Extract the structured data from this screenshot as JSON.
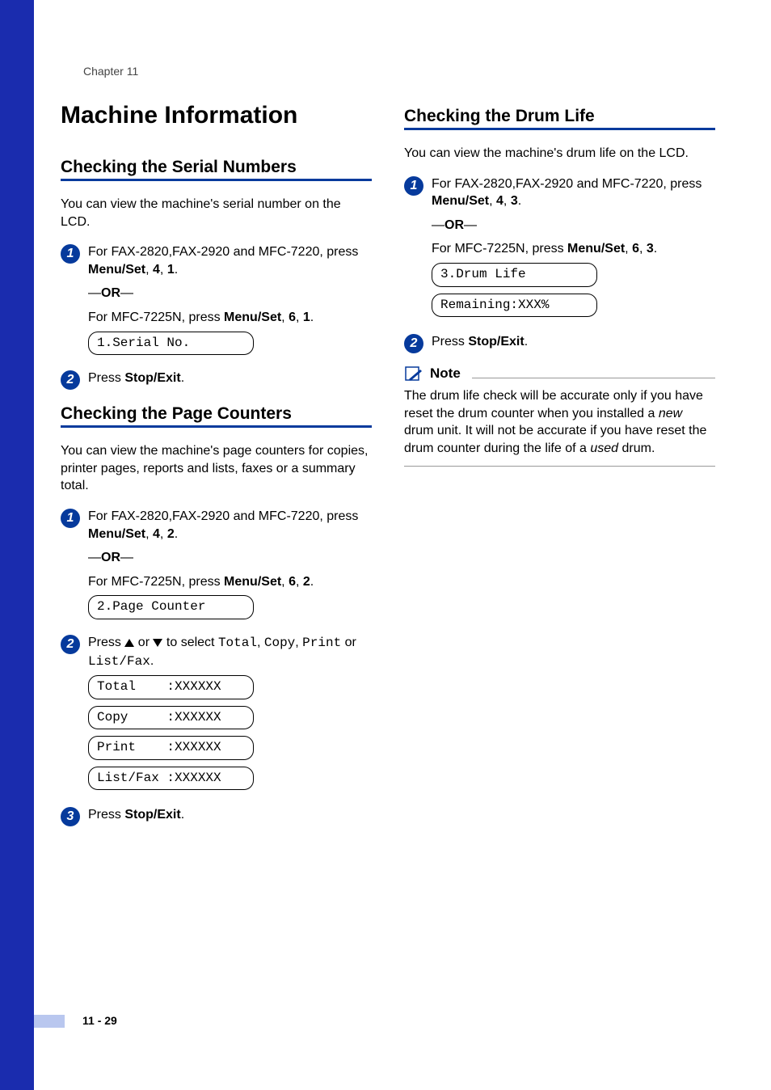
{
  "chapter": "Chapter 11",
  "page_number": "11 - 29",
  "h1": "Machine Information",
  "left": {
    "section1": {
      "heading": "Checking the Serial Numbers",
      "intro": "You can view the machine's serial number on the LCD.",
      "step1_a": "For FAX-2820,FAX-2920 and MFC-7220, press ",
      "menu_set": "Menu/Set",
      "comma": ", ",
      "four": "4",
      "one": "1",
      "period": ".",
      "or": "OR",
      "step1_b_pre": "For MFC-7225N, press ",
      "six": "6",
      "lcd1": "1.Serial No.",
      "step2_pre": "Press ",
      "stop_exit": "Stop/Exit",
      "step2_post": "."
    },
    "section2": {
      "heading": "Checking the Page Counters",
      "intro": "You can view the machine's page counters for copies, printer pages, reports and lists, faxes or a summary total.",
      "step1_a": "For FAX-2820,FAX-2920 and MFC-7220, press ",
      "menu_set": "Menu/Set",
      "comma": ", ",
      "four": "4",
      "two": "2",
      "period": ".",
      "or": "OR",
      "step1_b_pre": "For MFC-7225N, press ",
      "six": "6",
      "lcd1": "2.Page Counter",
      "step2_pre": "Press ",
      "step2_mid1": " or ",
      "step2_mid2": " to select ",
      "opt_total": "Total",
      "opt_copy": "Copy",
      "opt_print": "Print",
      "step2_or": " or ",
      "opt_listfax": "List/Fax",
      "step2_end": ".",
      "sep": ", ",
      "lcd_total": "Total    :XXXXXX",
      "lcd_copy": "Copy     :XXXXXX",
      "lcd_print": "Print    :XXXXXX",
      "lcd_listfax": "List/Fax :XXXXXX",
      "step3_pre": "Press ",
      "stop_exit": "Stop/Exit",
      "step3_post": "."
    }
  },
  "right": {
    "section1": {
      "heading": "Checking the Drum Life",
      "intro": "You can view the machine's drum life on the LCD.",
      "step1_a": "For FAX-2820,FAX-2920 and MFC-7220, press ",
      "menu_set": "Menu/Set",
      "comma": ", ",
      "four": "4",
      "three": "3",
      "period": ".",
      "or": "OR",
      "step1_b_pre": "For MFC-7225N, press ",
      "six": "6",
      "lcd1": "3.Drum Life",
      "lcd2": "Remaining:XXX%",
      "step2_pre": "Press ",
      "stop_exit": "Stop/Exit",
      "step2_post": ".",
      "note_label": "Note",
      "note_body_1": "The drum life check will be accurate only if you have reset the drum counter when you installed a ",
      "note_new": "new",
      "note_body_2": " drum unit. It will not be accurate if you have reset the drum counter during the life of a ",
      "note_used": "used",
      "note_body_3": " drum."
    }
  }
}
